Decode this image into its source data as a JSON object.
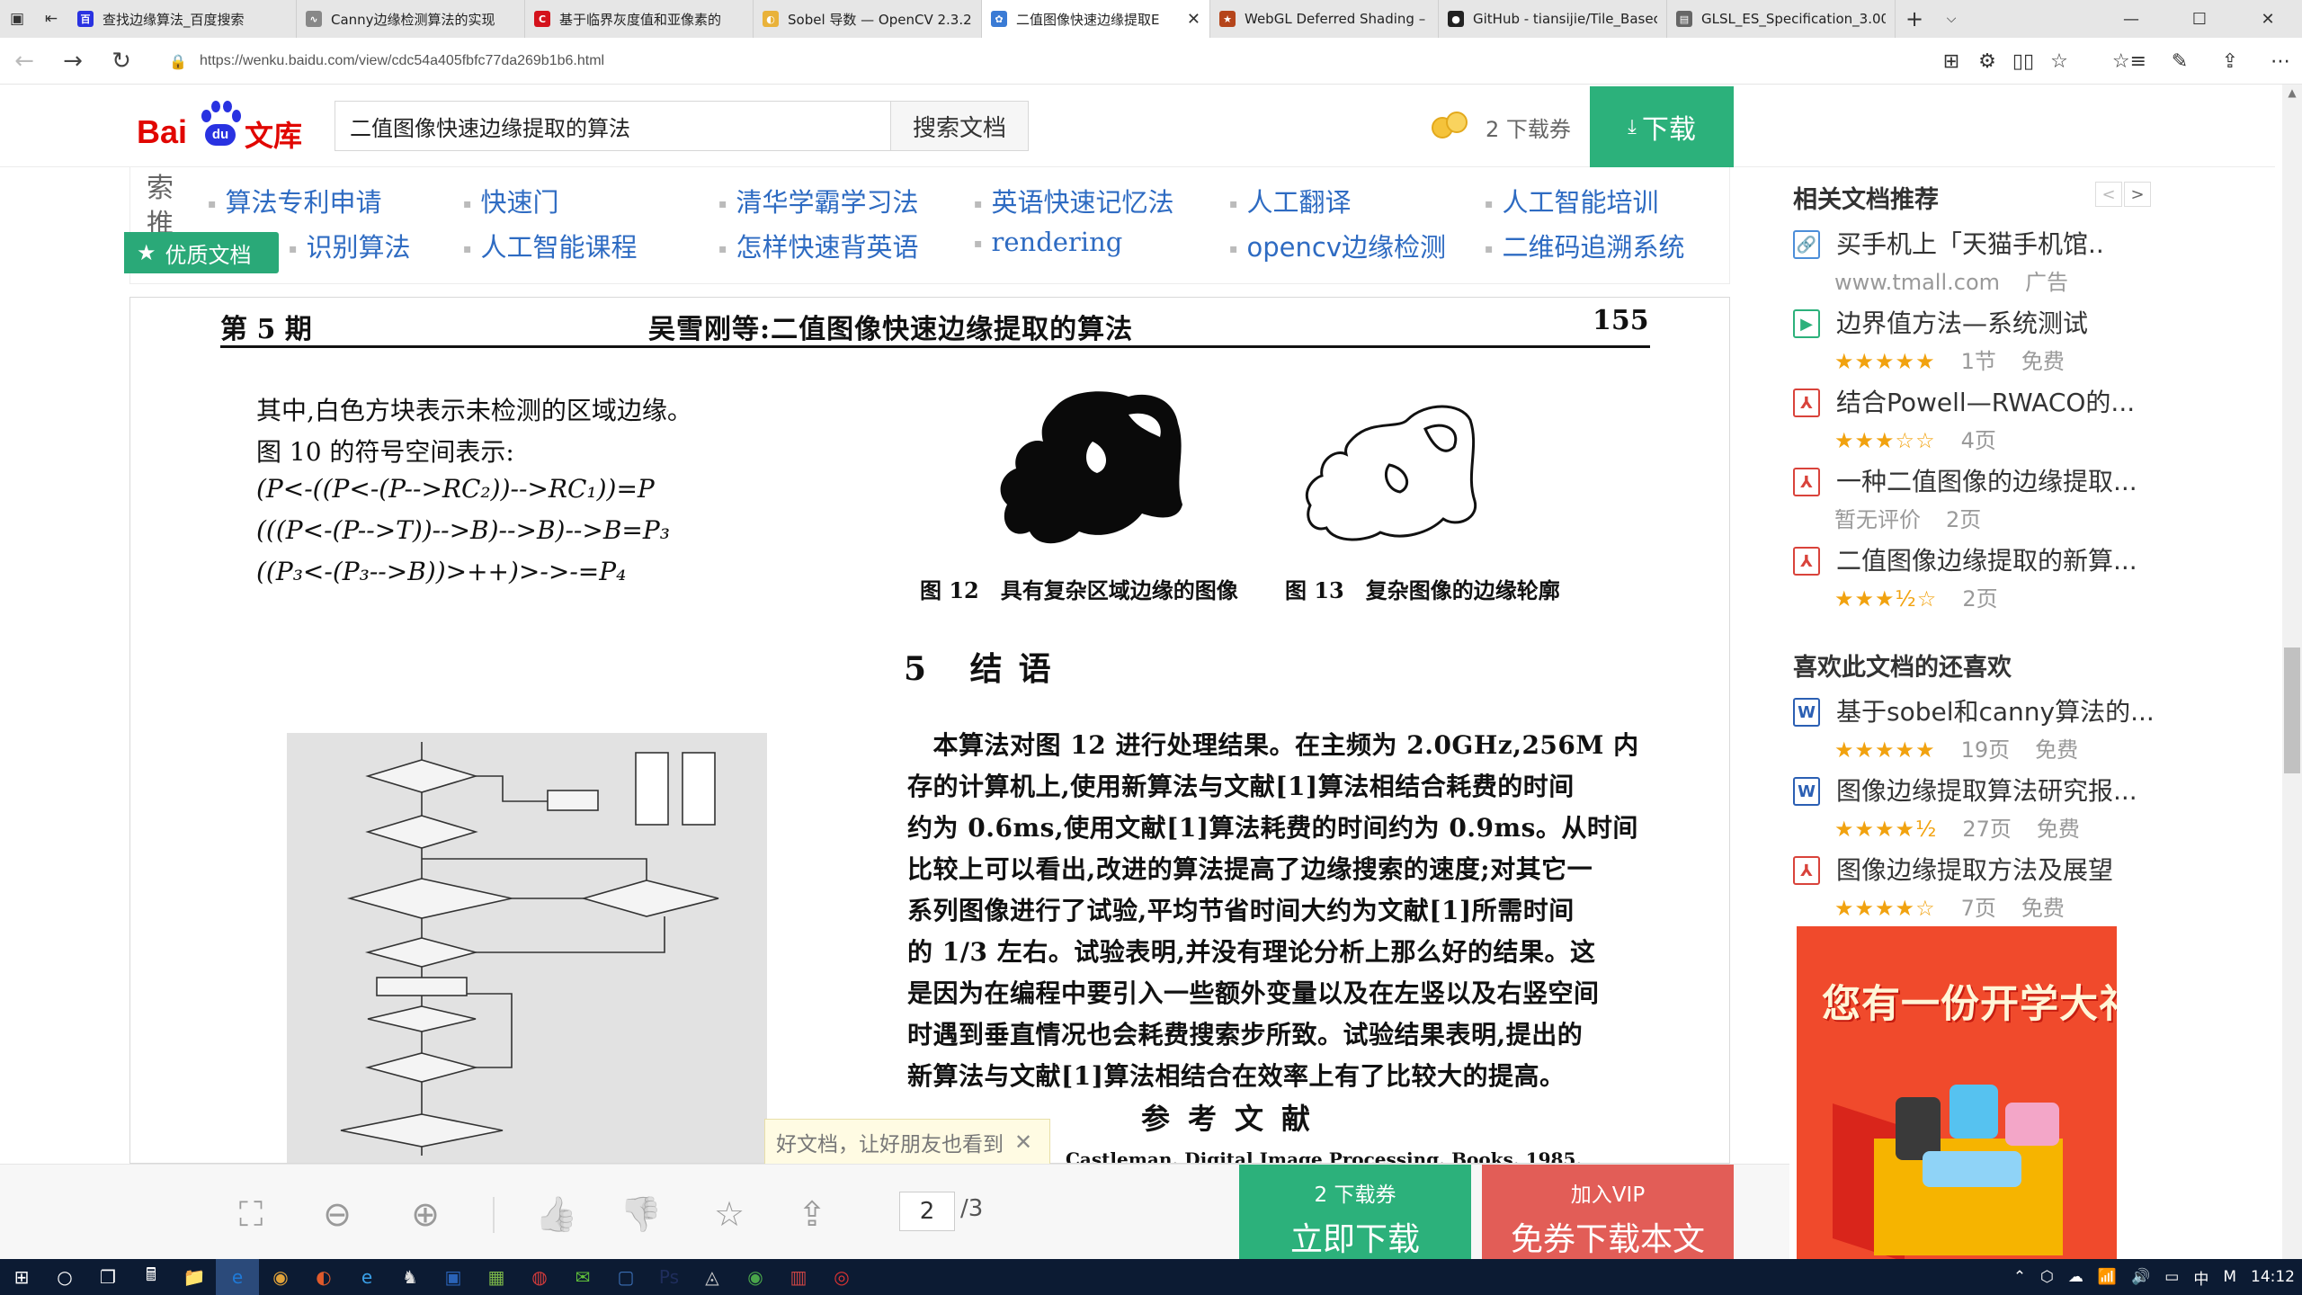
{
  "browser": {
    "tabs": [
      {
        "title": "查找边缘算法_百度搜索",
        "color": "#2932e1",
        "glyph": "百"
      },
      {
        "title": "Canny边缘检测算法的实现",
        "color": "#888888",
        "glyph": "∿"
      },
      {
        "title": "基于临界灰度值和亚像素的",
        "color": "#d4121b",
        "glyph": "C"
      },
      {
        "title": "Sobel 导数 — OpenCV 2.3.2",
        "color": "#e9b23a",
        "glyph": "◐"
      },
      {
        "title": "二值图像快速边缘提取E",
        "color": "#3a7bd5",
        "glyph": "✿",
        "active": true
      },
      {
        "title": "WebGL Deferred Shading –",
        "color": "#b5451b",
        "glyph": "★"
      },
      {
        "title": "GitHub - tiansijie/Tile_Basec",
        "color": "#222222",
        "glyph": "●"
      },
      {
        "title": "GLSL_ES_Specification_3.00.",
        "color": "#666666",
        "glyph": "▤"
      }
    ],
    "new_tab": "+",
    "tab_dropdown": "⌵",
    "url": "https://wenku.baidu.com/view/cdc54a405fbfc77da269b1b6.html",
    "window_controls": {
      "minimize": "—",
      "maximize": "☐",
      "close": "✕"
    },
    "nav": {
      "back": "←",
      "forward": "→",
      "refresh": "↻"
    },
    "addr_icons": [
      "⊞",
      "⚙",
      "▯▯",
      "☆"
    ],
    "right_icons": [
      "☆≡",
      "✎",
      "⇪",
      "⋯"
    ]
  },
  "site": {
    "logo_bai": "Bai",
    "logo_du": "du",
    "logo_wenku": "文库",
    "search_value": "二值图像快速边缘提取的算法",
    "search_button": "搜索文档",
    "voucher_text": "2 下载券",
    "download_label": "下载",
    "download_icon": "⤓"
  },
  "keywords": {
    "side_label": [
      "索",
      "推"
    ],
    "row1": [
      "算法专利申请",
      "快速门",
      "清华学霸学习法",
      "英语快速记忆法",
      "人工翻译",
      "人工智能培训"
    ],
    "row2": [
      "识别算法",
      "人工智能课程",
      "怎样快速背英语",
      "rendering",
      "opencv边缘检测",
      "二维码追溯系统"
    ],
    "quality_badge": "优质文档",
    "quality_star": "★"
  },
  "doc": {
    "issue": "第 5 期",
    "running_title": "吴雪刚等:二值图像快速边缘提取的算法",
    "page_number": "155",
    "lines": [
      "其中,白色方块表示未检测的区域边缘。",
      "图 10 的符号空间表示:"
    ],
    "formulas": [
      "(P<-((P<-(P-->RC₂))-->RC₁))=P",
      "(((P<-(P-->T))-->B)-->B)-->B=P₃",
      "((P₃<-(P₃-->B))>++)>->-=P₄"
    ],
    "fig12_caption": "图 12　具有复杂区域边缘的图像",
    "fig13_caption": "图 13　复杂图像的边缘轮廓",
    "section_heading": "5 结语",
    "conclusion_lines": [
      "　本算法对图 12 进行处理结果。在主频为 2.0GHz,256M 内",
      "存的计算机上,使用新算法与文献[1]算法相结合耗费的时间",
      "约为 0.6ms,使用文献[1]算法耗费的时间约为 0.9ms。从时间",
      "比较上可以看出,改进的算法提高了边缘搜索的速度;对其它一",
      "系列图像进行了试验,平均节省时间大约为文献[1]所需时间",
      "的 1/3 左右。试验表明,并没有理论分析上那么好的结果。这",
      "是因为在编程中要引入一些额外变量以及在左竖以及右竖空间",
      "时遇到垂直情况也会耗费搜索步所致。试验结果表明,提出的",
      "新算法与文献[1]算法相结合在效率上有了比较大的提高。"
    ],
    "references_heading": "参考文献",
    "reference_partial": "Castleman. Digital Image Processing. Books. 1985."
  },
  "share_tip": {
    "text": "好文档，让好朋友也看到",
    "close": "✕"
  },
  "toolbar": {
    "fullscreen": "⛶",
    "zoom_out": "⊖",
    "zoom_in": "⊕",
    "like": "👍",
    "dislike": "👎",
    "favorite": "☆",
    "share": "⇪",
    "current_page": "2",
    "total_pages": "/3",
    "download_now_top": "2 下载券",
    "download_now": "立即下载",
    "vip_top": "加入VIP",
    "vip_download": "免券下载本文"
  },
  "sidebar": {
    "related_title": "相关文档推荐",
    "pager_prev": "<",
    "pager_next": ">",
    "related": [
      {
        "name": "买手机上「天猫手机馆..",
        "meta_text": "www.tmall.com",
        "extra": "广告",
        "icon": "link",
        "glyph": "🔗",
        "color": "#4c8ed9"
      },
      {
        "name": "边界值方法—系统测试",
        "stars": "★★★★★",
        "count": "1节",
        "fee": "免费",
        "icon": "video",
        "glyph": "▶",
        "color": "#2cb17b"
      },
      {
        "name": "结合Powell—RWACO的...",
        "stars": "★★★☆☆",
        "count": "4页",
        "fee": "",
        "icon": "pdf",
        "glyph": "⅄",
        "color": "#d9433b"
      },
      {
        "name": "一种二值图像的边缘提取...",
        "meta_text": "暂无评价",
        "count": "2页",
        "fee": "",
        "icon": "pdf",
        "glyph": "⅄",
        "color": "#d9433b"
      },
      {
        "name": "二值图像边缘提取的新算...",
        "stars": "★★★½☆",
        "count": "2页",
        "fee": "",
        "icon": "pdf",
        "glyph": "⅄",
        "color": "#d9433b"
      }
    ],
    "also_like_title": "喜欢此文档的还喜欢",
    "also_like": [
      {
        "name": "基于sobel和canny算法的...",
        "stars": "★★★★★",
        "count": "19页",
        "fee": "免费",
        "icon": "word",
        "glyph": "W",
        "color": "#2b5fb3"
      },
      {
        "name": "图像边缘提取算法研究报...",
        "stars": "★★★★½",
        "count": "27页",
        "fee": "免费",
        "icon": "word",
        "glyph": "W",
        "color": "#2b5fb3"
      },
      {
        "name": "图像边缘提取方法及展望",
        "stars": "★★★★☆",
        "count": "7页",
        "fee": "免费",
        "icon": "pdf",
        "glyph": "⅄",
        "color": "#d9433b"
      }
    ],
    "promo_text": "您有一份开学大礼未领取",
    "promo_close": "✕"
  },
  "taskbar": {
    "start": "⊞",
    "search": "○",
    "task_view": "❐",
    "apps": [
      "🖩",
      "📁",
      "e",
      "◉",
      "◐",
      "e",
      "♞",
      "▣",
      "▦",
      "◍",
      "✉",
      "▢",
      "Ps",
      "◬",
      "◉",
      "▥",
      "◎"
    ],
    "tray": [
      "⌃",
      "⬡",
      "☁",
      "📶",
      "🔊",
      "▭",
      "中",
      "M",
      "14:12"
    ],
    "clock": "14:12"
  }
}
